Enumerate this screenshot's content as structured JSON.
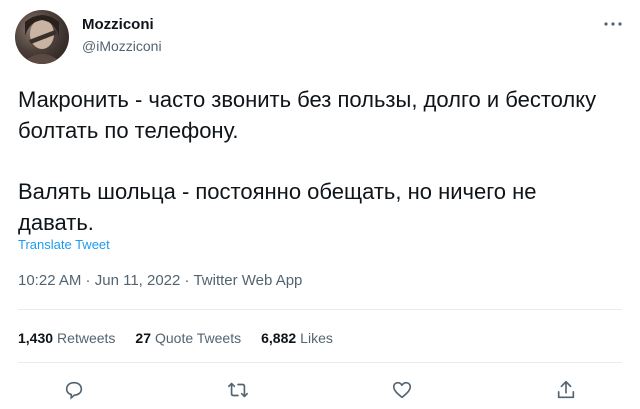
{
  "author": {
    "name": "Mozziconi",
    "handle": "@iMozziconi"
  },
  "more_menu_icon": "more-dots-icon",
  "tweet": {
    "paragraphs": [
      "Макронить - часто звонить без пользы, долго и бестолку болтать по телефону.",
      "Валять шольца - постоянно обещать, но ничего не давать."
    ],
    "translate_label": "Translate Tweet",
    "time": "10:22 AM",
    "date": "Jun 11, 2022",
    "source": "Twitter Web App"
  },
  "stats": {
    "retweets_count": "1,430",
    "retweets_label": "Retweets",
    "quotes_count": "27",
    "quotes_label": "Quote Tweets",
    "likes_count": "6,882",
    "likes_label": "Likes"
  },
  "actions": [
    "reply-icon",
    "retweet-icon",
    "like-icon",
    "share-icon"
  ],
  "colors": {
    "link": "#1d9bf0",
    "secondary_text": "#536471",
    "primary_text": "#0f1419"
  }
}
